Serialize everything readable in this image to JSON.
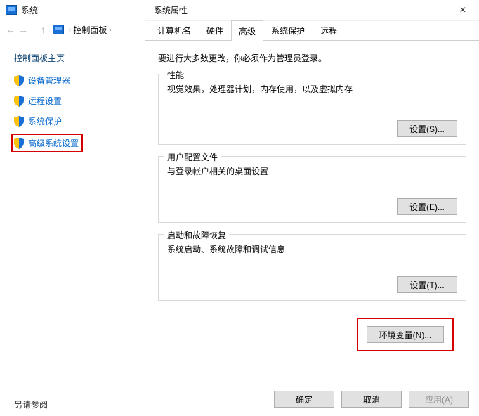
{
  "left": {
    "window_title": "系统",
    "breadcrumb": "控制面板",
    "heading": "控制面板主页",
    "items": [
      {
        "label": "设备管理器",
        "shield": true
      },
      {
        "label": "远程设置",
        "shield": true
      },
      {
        "label": "系统保护",
        "shield": true
      },
      {
        "label": "高级系统设置",
        "shield": true
      }
    ],
    "footer": "另请参阅"
  },
  "dialog": {
    "title": "系统属性",
    "tabs": [
      {
        "label": "计算机名"
      },
      {
        "label": "硬件"
      },
      {
        "label": "高级"
      },
      {
        "label": "系统保护"
      },
      {
        "label": "远程"
      }
    ],
    "active_tab_index": 2,
    "notice": "要进行大多数更改，你必须作为管理员登录。",
    "groups": [
      {
        "title": "性能",
        "desc": "视觉效果，处理器计划，内存使用，以及虚拟内存",
        "button": "设置(S)..."
      },
      {
        "title": "用户配置文件",
        "desc": "与登录帐户相关的桌面设置",
        "button": "设置(E)..."
      },
      {
        "title": "启动和故障恢复",
        "desc": "系统启动、系统故障和调试信息",
        "button": "设置(T)..."
      }
    ],
    "env_button": "环境变量(N)...",
    "footer": {
      "ok": "确定",
      "cancel": "取消",
      "apply": "应用(A)"
    }
  }
}
